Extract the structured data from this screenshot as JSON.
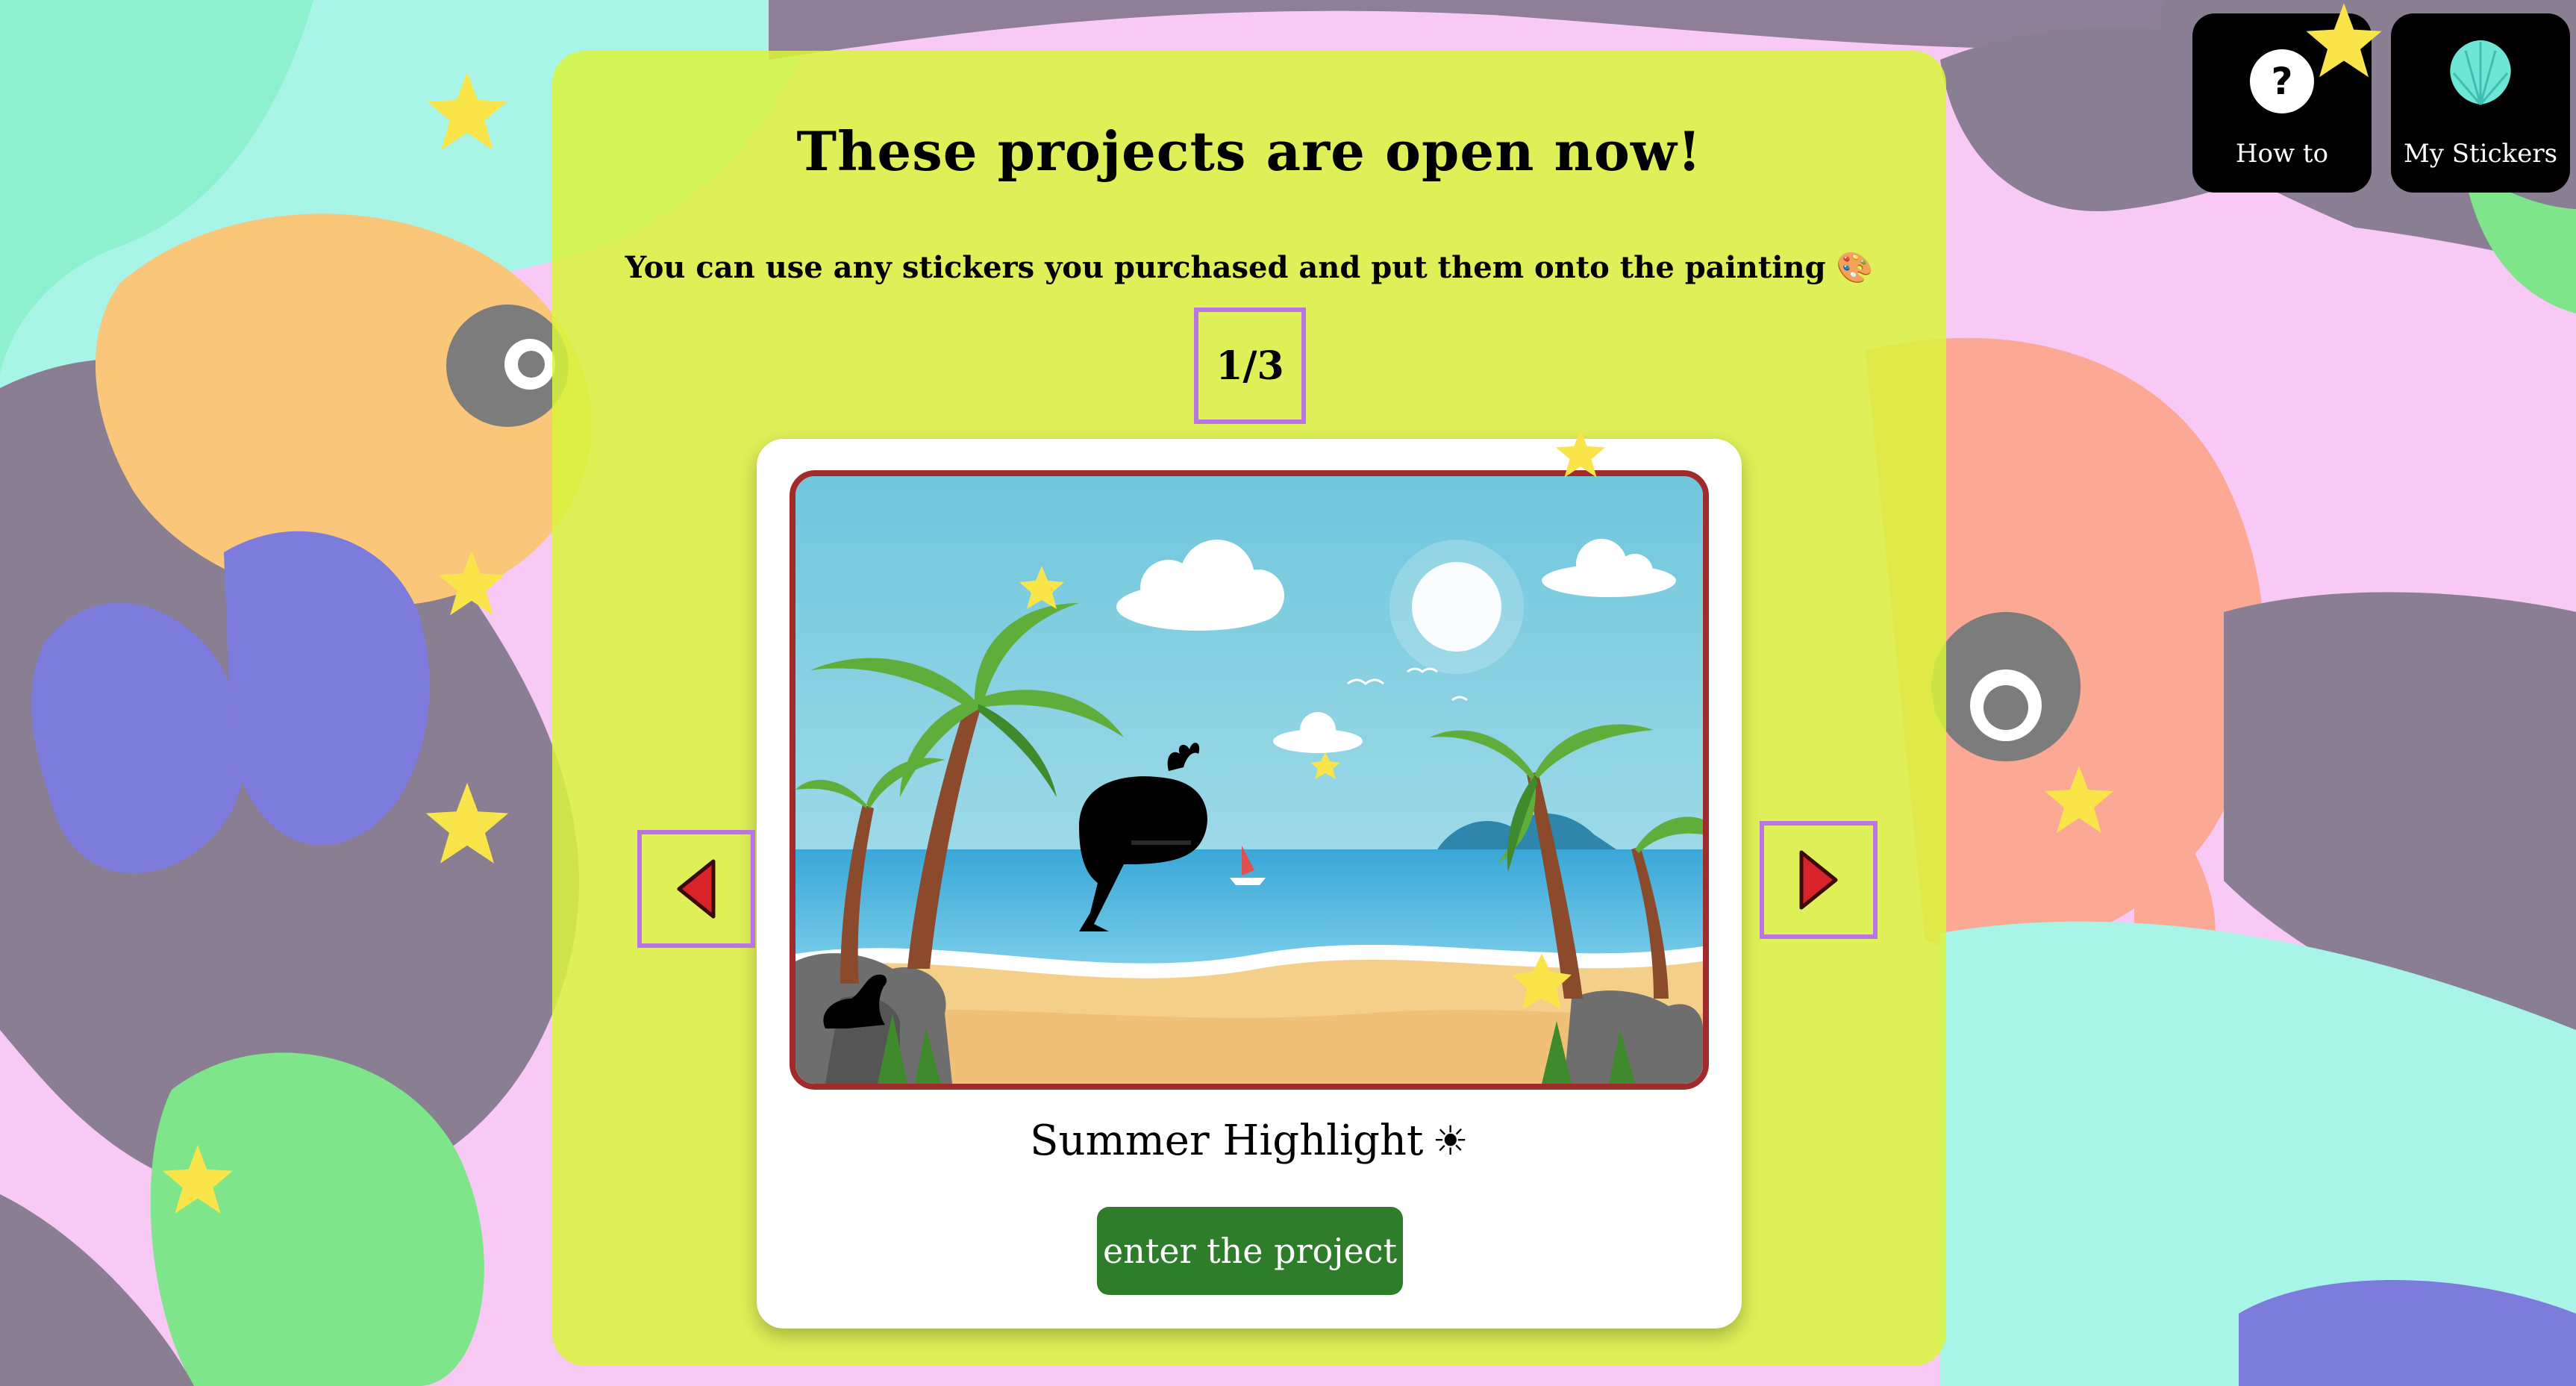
{
  "header": {
    "title": "These projects are open now!",
    "subtitle": "You can use any stickers you purchased and put them onto the painting",
    "subtitle_icon": "palette-icon"
  },
  "carousel": {
    "counter": "1/3",
    "prev_icon": "caret-left-icon",
    "next_icon": "caret-right-icon"
  },
  "project": {
    "name": "Summer Highlight",
    "name_icon": "sun-icon",
    "enter_label": "enter the project"
  },
  "top_buttons": {
    "how_to": {
      "label": "How to",
      "icon": "question-icon"
    },
    "my_stickers": {
      "label": "My Stickers",
      "icon": "shell-icon"
    }
  },
  "colors": {
    "panel": "#daf53c",
    "enter_button": "#2d7d2a",
    "frame_border": "#a12a2a",
    "pager_outline": "#b974e6",
    "star": "#f9e54a"
  }
}
